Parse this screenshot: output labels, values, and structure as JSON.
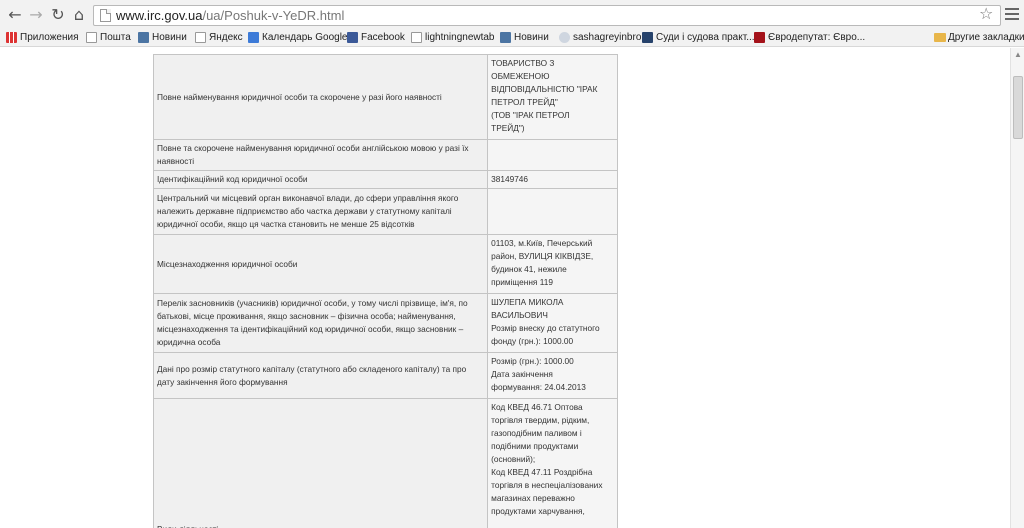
{
  "browser": {
    "url_host": "www.irc.gov.ua",
    "url_path": "/ua/Poshuk-v-YeDR.html"
  },
  "bookmarks": [
    {
      "label": "Приложения",
      "icon": "apps-icon"
    },
    {
      "label": "Пошта",
      "icon": "page-icon"
    },
    {
      "label": "Новини",
      "icon": "vk-icon"
    },
    {
      "label": "Яндекс",
      "icon": "page-icon"
    },
    {
      "label": "Календарь Google",
      "icon": "calendar-icon"
    },
    {
      "label": "Facebook",
      "icon": "facebook-icon"
    },
    {
      "label": "lightningnewtab",
      "icon": "page-icon"
    },
    {
      "label": "Новини",
      "icon": "vk-icon"
    },
    {
      "label": "sashagreyinbro",
      "icon": "user-icon"
    },
    {
      "label": "Суди і судова практ...",
      "icon": "ps-icon"
    },
    {
      "label": "Євродепутат: Євро...",
      "icon": "eu-icon"
    },
    {
      "label": "Другие закладки",
      "icon": "folder-icon"
    }
  ],
  "table": {
    "rows": [
      {
        "label": "Повне найменування юридичної особи та скорочене у разі його наявності",
        "value": "ТОВАРИСТВО З\nОБМЕЖЕНОЮ\nВІДПОВІДАЛЬНІСТЮ \"ІРАК\nПЕТРОЛ ТРЕЙД\"\n(ТОВ \"ІРАК ПЕТРОЛ\nТРЕЙД\")"
      },
      {
        "label": "Повне та скорочене найменування юридичної особи англійською мовою у разі їх наявності",
        "value": ""
      },
      {
        "label": "Ідентифікаційний код юридичної особи",
        "value": "38149746"
      },
      {
        "label": "Центральний чи місцевий орган виконавчої влади, до сфери управління якого належить державне підприємство або частка держави у статутному капіталі юридичної особи, якщо ця частка становить не менше 25 відсотків",
        "value": ""
      },
      {
        "label": "Місцезнаходження юридичної особи",
        "value": "01103, м.Київ, Печерський\nрайон, ВУЛИЦЯ КІКВІДЗЕ,\nбудинок 41, нежиле\nприміщення 119"
      },
      {
        "label": "Перелік засновників (учасників) юридичної особи, у тому числі прізвище, ім'я, по батькові, місце проживання, якщо засновник – фізична особа; найменування, місцезнаходження та ідентифікаційний код юридичної особи, якщо засновник – юридична особа",
        "value": "ШУЛЕПА МИКОЛА\nВАСИЛЬОВИЧ\nРозмір внеску до статутного\nфонду (грн.): 1000.00"
      },
      {
        "label": "Дані про розмір статутного капіталу (статутного або складеного капіталу) та про дату закінчення його формування",
        "value": "Розмір (грн.): 1000.00\nДата закінчення\nформування: 24.04.2013"
      },
      {
        "label": "Види діяльності",
        "value": "Код КВЕД 46.71 Оптова\nторгівля твердим, рідким,\nгазоподібним паливом і\nподібними продуктами\n(основний);\nКод КВЕД 47.11 Роздрібна\nторгівля в неспеціалізованих\nмагазинах переважно\nпродуктами харчування,"
      }
    ]
  }
}
